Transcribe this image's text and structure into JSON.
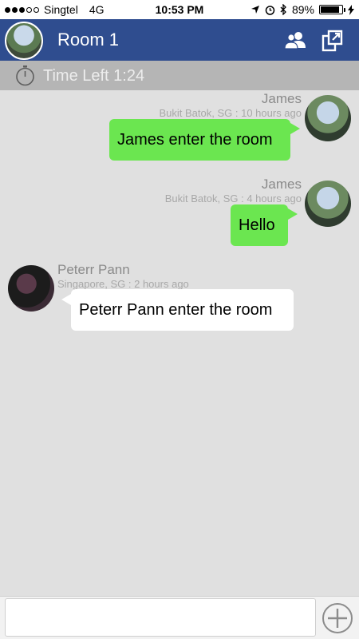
{
  "status_bar": {
    "carrier": "Singtel",
    "network": "4G",
    "time": "10:53 PM",
    "battery": "89%",
    "battery_level": 0.89,
    "icons": [
      "signal-dots-icon",
      "location-arrow-icon",
      "alarm-icon",
      "bluetooth-icon",
      "battery-icon",
      "charging-bolt-icon"
    ]
  },
  "header": {
    "title": "Room 1",
    "icons": [
      "room-avatar",
      "people-icon",
      "share-icon"
    ],
    "color": "#2f4d8f"
  },
  "timer": {
    "label": "Time Left 1:24",
    "icon": "stopwatch-icon"
  },
  "messages": [
    {
      "sender": "James",
      "meta": "Bukit Batok, SG : 10 hours ago",
      "text": "James enter the room",
      "side": "right",
      "bubble_color": "#6be650"
    },
    {
      "sender": "James",
      "meta": "Bukit Batok, SG : 4 hours ago",
      "text": "Hello",
      "side": "right",
      "bubble_color": "#6be650"
    },
    {
      "sender": "Peterr Pann",
      "meta": "Singapore, SG : 2 hours ago",
      "text": "Peterr Pann enter the room",
      "side": "left",
      "bubble_color": "#ffffff"
    }
  ],
  "input": {
    "placeholder": "",
    "value": "",
    "add_icon": "plus-circle-icon"
  }
}
